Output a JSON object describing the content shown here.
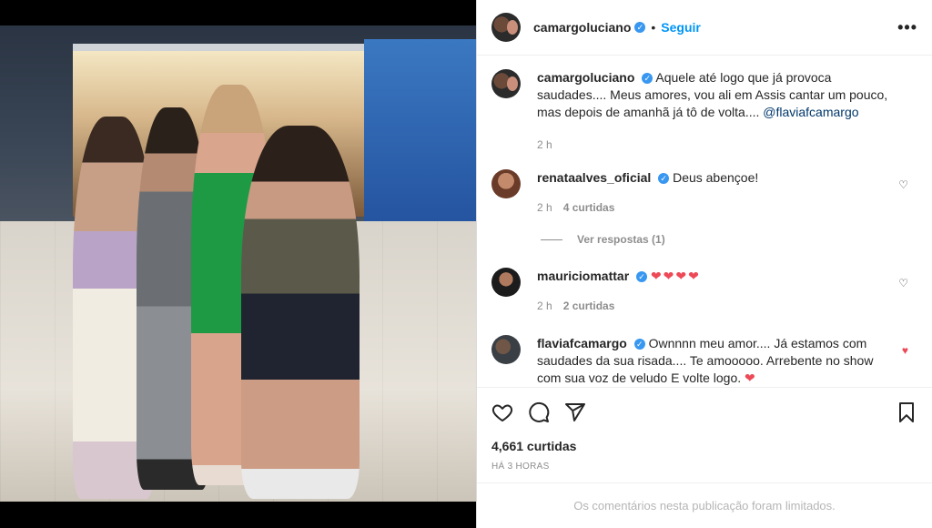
{
  "post": {
    "username": "camargoluciano",
    "follow_label": "Seguir",
    "more_label": "•••",
    "separator": "•",
    "verified_glyph": "✓"
  },
  "comments": [
    {
      "username": "camargoluciano",
      "text": "Aquele até logo que já provoca saudades.... Meus amores, vou ali em Assis cantar um pouco, mas depois de amanhã já tô de volta....",
      "mention": "@flaviafcamargo",
      "time": "2 h",
      "likes": ""
    },
    {
      "username": "renataalves_oficial",
      "text": "Deus abençoe!",
      "time": "2 h",
      "likes": "4 curtidas",
      "replies": "Ver respostas (1)",
      "liked": false
    },
    {
      "username": "mauriciomattar",
      "text": "❤❤❤❤",
      "time": "2 h",
      "likes": "2 curtidas",
      "liked": false
    },
    {
      "username": "flaviafcamargo",
      "text": "Ownnnn meu amor.... Já estamos com saudades da sua risada.... Te amooooo. Arrebente no show com sua voz de veludo E volte logo.",
      "heart": "❤",
      "liked": true
    }
  ],
  "footer": {
    "likes_label": "4,661 curtidas",
    "time_label": "HÁ 3 HORAS",
    "limited_label": "Os comentários nesta publicação foram limitados."
  },
  "icons": {
    "like": "heart-icon",
    "comment": "comment-icon",
    "share": "share-icon",
    "save": "bookmark-icon",
    "comment_like": "heart-small-icon"
  },
  "colors": {
    "accent": "#0095f6",
    "heart": "#ed4956",
    "muted": "#8e8e8e",
    "verified": "#3897f0"
  }
}
